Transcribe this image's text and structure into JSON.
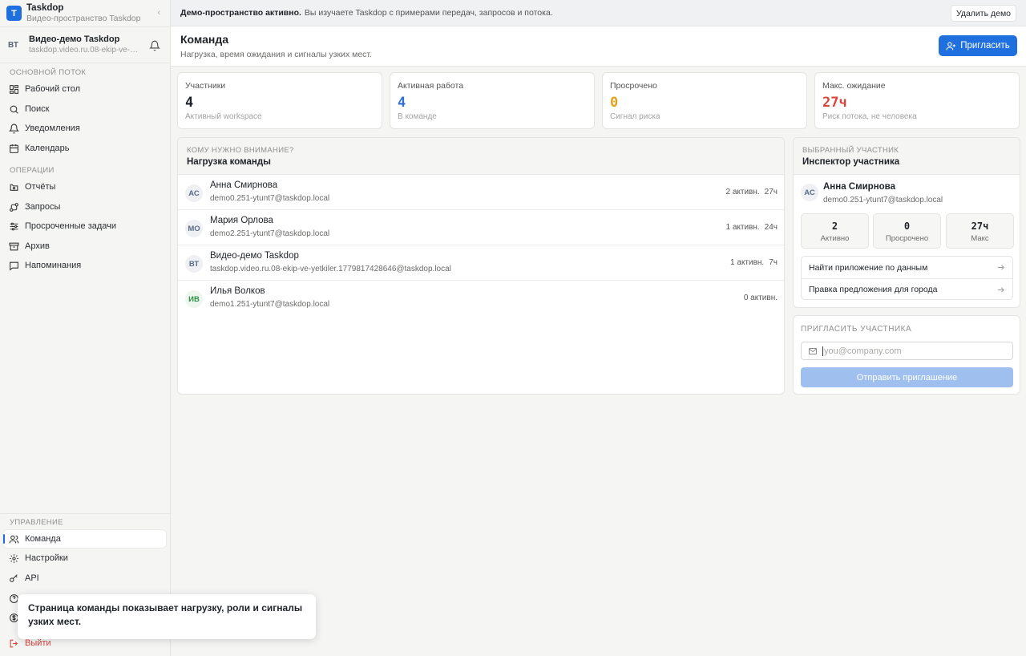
{
  "app": {
    "name": "Taskdop",
    "subtitle": "Видео-пространство Taskdop",
    "logo_letter": "T",
    "brand_color": "#1f6fde"
  },
  "workspace": {
    "initials": "ВТ",
    "name": "Видео-демо Taskdop",
    "email": "taskdop.video.ru.08-ekip-ve-…"
  },
  "sidebar": {
    "section_main": "ОСНОВНОЙ ПОТОК",
    "main_items": [
      {
        "label": "Рабочий стол",
        "icon": "dashboard-icon"
      },
      {
        "label": "Поиск",
        "icon": "search-icon"
      },
      {
        "label": "Уведомления",
        "icon": "bell-icon"
      },
      {
        "label": "Календарь",
        "icon": "calendar-icon"
      }
    ],
    "section_ops": "ОПЕРАЦИИ",
    "ops_items": [
      {
        "label": "Отчёты",
        "icon": "reports-icon"
      },
      {
        "label": "Запросы",
        "icon": "requests-icon"
      },
      {
        "label": "Просроченные задачи",
        "icon": "sliders-icon"
      },
      {
        "label": "Архив",
        "icon": "archive-icon"
      },
      {
        "label": "Напоминания",
        "icon": "message-icon"
      }
    ],
    "section_manage": "УПРАВЛЕНИЕ",
    "manage_items": [
      {
        "label": "Команда",
        "icon": "team-icon",
        "active": true
      },
      {
        "label": "Настройки",
        "icon": "gear-icon"
      },
      {
        "label": "API",
        "icon": "key-icon"
      }
    ],
    "logout": "Выйти"
  },
  "banner": {
    "bold": "Демо-пространство активно.",
    "text": "Вы изучаете Taskdop с примерами передач, запросов и потока.",
    "delete_button": "Удалить демо"
  },
  "header": {
    "title": "Команда",
    "subtitle": "Нагрузка, время ожидания и сигналы узких мест.",
    "invite_button": "Пригласить"
  },
  "stats": [
    {
      "label": "Участники",
      "value": "4",
      "sub": "Активный workspace",
      "color": "#1f2328"
    },
    {
      "label": "Активная работа",
      "value": "4",
      "sub": "В команде",
      "color": "#2f6fd6"
    },
    {
      "label": "Просрочено",
      "value": "0",
      "sub": "Сигнал риска",
      "color": "#e0a21a"
    },
    {
      "label": "Макс. ожидание",
      "value": "27ч",
      "sub": "Риск потока, не человека",
      "color": "#d9443b"
    }
  ],
  "workload": {
    "eyebrow": "КОМУ НУЖНО ВНИМАНИЕ?",
    "title": "Нагрузка команды",
    "members": [
      {
        "initials": "АС",
        "name": "Анна Смирнова",
        "email": "demo0.251-ytunt7@taskdop.local",
        "active": "2 активн.",
        "wait": "27ч"
      },
      {
        "initials": "МО",
        "name": "Мария Орлова",
        "email": "demo2.251-ytunt7@taskdop.local",
        "active": "1 активн.",
        "wait": "24ч"
      },
      {
        "initials": "ВТ",
        "name": "Видео-демо Taskdop",
        "email": "taskdop.video.ru.08-ekip-ve-yetkiler.1779817428646@taskdop.local",
        "active": "1 активн.",
        "wait": "7ч"
      },
      {
        "initials": "ИВ",
        "name": "Илья Волков",
        "email": "demo1.251-ytunt7@taskdop.local",
        "active": "0 активн.",
        "wait": ""
      }
    ]
  },
  "inspector": {
    "eyebrow": "ВЫБРАННЫЙ УЧАСТНИК",
    "title": "Инспектор участника",
    "initials": "АС",
    "name": "Анна Смирнова",
    "email": "demo0.251-ytunt7@taskdop.local",
    "metrics": [
      {
        "value": "2",
        "label": "Активно"
      },
      {
        "value": "0",
        "label": "Просрочено"
      },
      {
        "value": "27ч",
        "label": "Макс"
      }
    ],
    "links": [
      "Найти приложение по данным",
      "Правка предложения для города"
    ]
  },
  "invite": {
    "title": "ПРИГЛАСИТЬ УЧАСТНИКА",
    "placeholder": "you@company.com",
    "send_button": "Отправить приглашение"
  },
  "toast": {
    "text": "Страница команды показывает нагрузку, роли и сигналы узких мест."
  }
}
